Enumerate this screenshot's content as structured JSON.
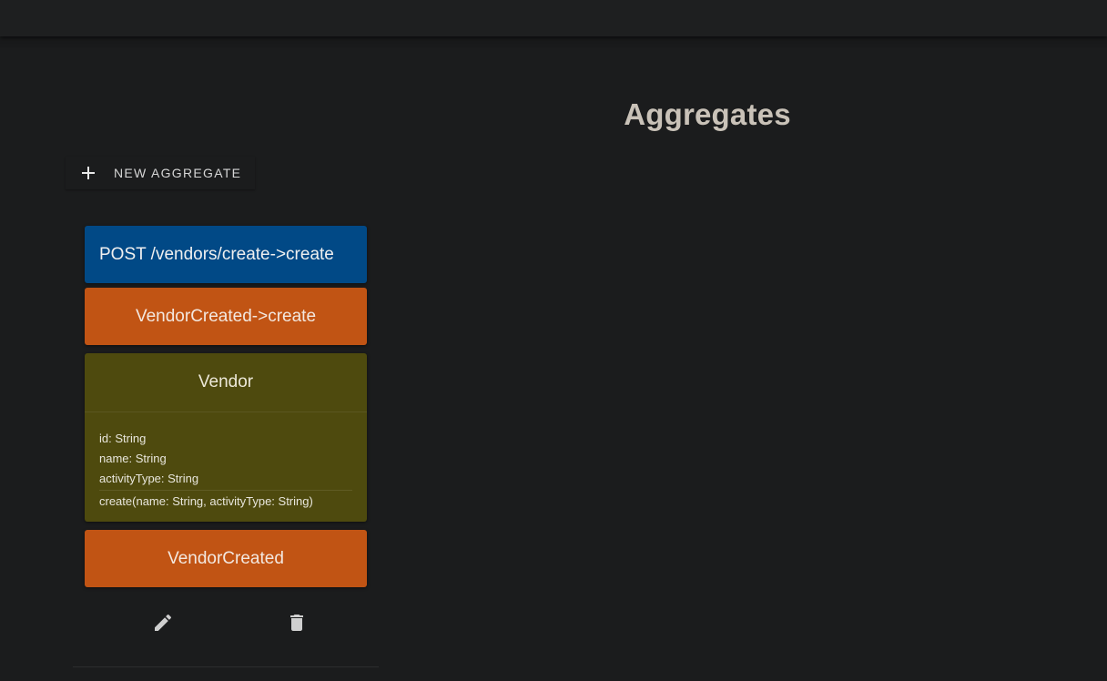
{
  "page": {
    "title": "Aggregates"
  },
  "toolbar": {
    "new_aggregate_label": "NEW AGGREGATE",
    "new_aggregate_icon": "plus-icon"
  },
  "aggregate_card": {
    "endpoint": "POST /vendors/create->create",
    "command_event": "VendorCreated->create",
    "aggregate": {
      "name": "Vendor",
      "fields": [
        "id: String",
        "name: String",
        "activityType: String"
      ],
      "methods": [
        "create(name: String, activityType: String)"
      ]
    },
    "event": "VendorCreated",
    "actions": {
      "edit_icon": "pencil-icon",
      "delete_icon": "trash-icon"
    }
  },
  "colors": {
    "background": "#191a1b",
    "endpoint": "#014986",
    "event": "#c15414",
    "aggregate": "#4e4a0e",
    "title": "#c9c2b8"
  }
}
